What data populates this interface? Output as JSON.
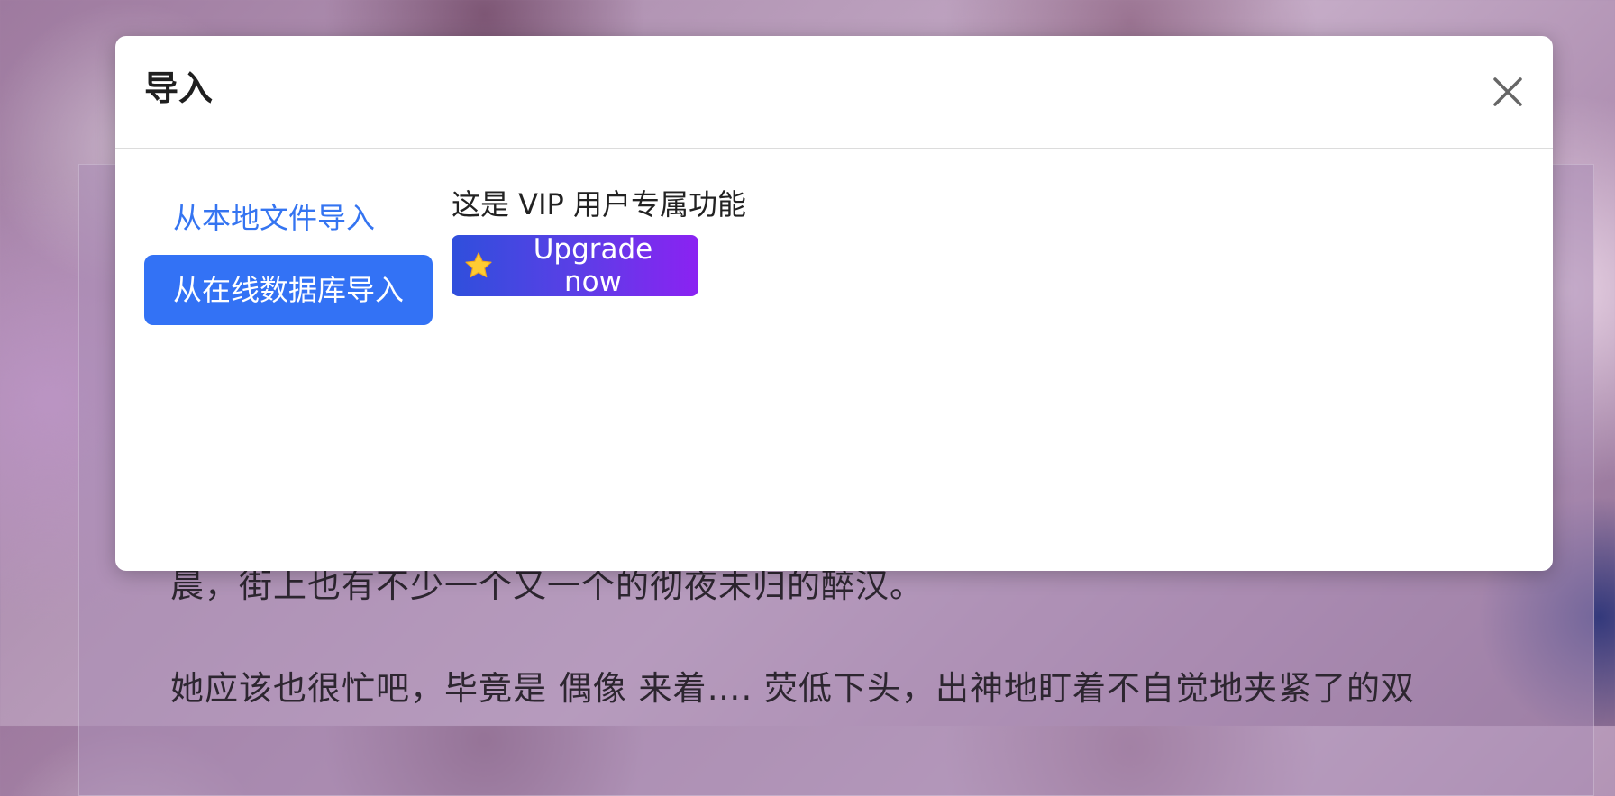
{
  "background": {
    "text_line_1": "晨，街上也有不少一个又一个的彻夜未归的醉汉。",
    "text_line_2": "她应该也很忙吧，毕竟是 偶像 来着…. 荧低下头，出神地盯着不自觉地夹紧了的双"
  },
  "modal": {
    "title": "导入",
    "close_icon": "close-icon",
    "nav": [
      {
        "label": "从本地文件导入",
        "active": false
      },
      {
        "label": "从在线数据库导入",
        "active": true
      }
    ],
    "vip_message": "这是 VIP 用户专属功能",
    "upgrade": {
      "icon": "star-icon",
      "label": "Upgrade now"
    }
  },
  "colors": {
    "accent": "#3372f5",
    "upgrade_gradient_start": "#2f4fdc",
    "upgrade_gradient_end": "#8b22f2"
  }
}
